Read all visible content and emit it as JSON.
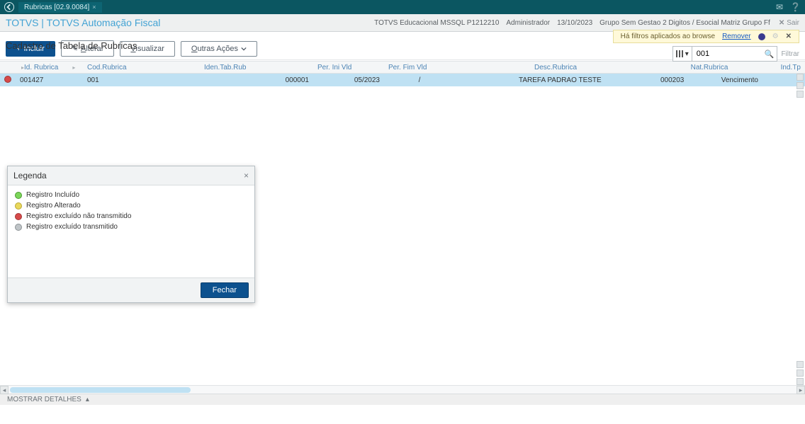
{
  "topbar": {
    "tab_title": "Rubricas [02.9.0084]",
    "mail_icon": "mail",
    "help_icon": "help"
  },
  "brand": {
    "name": "TOTVS | TOTVS Automação Fiscal",
    "env": "TOTVS Educacional MSSQL P1212210",
    "role": "Administrador",
    "date": "13/10/2023",
    "group": "Grupo Sem Gestao 2 Digitos / Esocial Matriz Grupo Ff",
    "exit": "Sair"
  },
  "page": {
    "title": "Cadastro de Tabela de Rubricas"
  },
  "filter_notice": {
    "text": "Há filtros aplicados ao browse",
    "remove": "Remover"
  },
  "search": {
    "value": "001",
    "filter_label": "Filtrar"
  },
  "toolbar": {
    "include": "Incluir",
    "alter": "Alterar",
    "alter_first": "A",
    "view": "Visualizar",
    "view_first": "V",
    "other": "Outras Ações",
    "other_first": "O"
  },
  "columns": {
    "id": "Id. Rubrica",
    "cod": "Cod.Rubrica",
    "iden": "Iden.Tab.Rub",
    "ini": "Per. Ini Vld",
    "fim": "Per. Fim Vld",
    "desc": "Desc.Rubrica",
    "nat": "Nat.Rubrica",
    "ind": "Ind.Tp"
  },
  "rows": [
    {
      "status": "red",
      "id": "001427",
      "cod": "001",
      "iden": "000001",
      "ini": "05/2023",
      "fim": "/",
      "desc": "TAREFA PADRAO TESTE",
      "nat": "000203",
      "nat_label": "Vencimento",
      "ind": ""
    }
  ],
  "legend": {
    "title": "Legenda",
    "items": [
      {
        "color": "green",
        "label": "Registro Incluído"
      },
      {
        "color": "yel",
        "label": "Registro Alterado"
      },
      {
        "color": "red",
        "label": "Registro excluído não transmitido"
      },
      {
        "color": "gray",
        "label": "Registro excluído transmitido"
      }
    ],
    "close": "Fechar"
  },
  "footer": {
    "details": "MOSTRAR DETALHES"
  }
}
